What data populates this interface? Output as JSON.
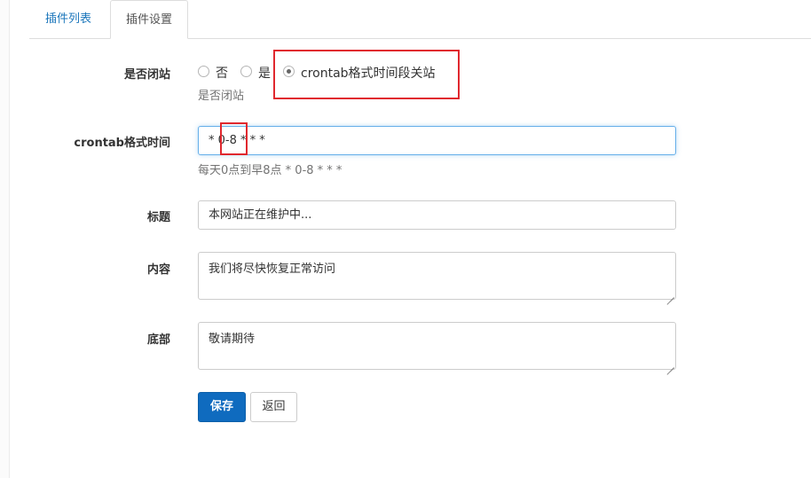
{
  "tabs": [
    {
      "label": "插件列表"
    },
    {
      "label": "插件设置"
    }
  ],
  "form": {
    "close_site": {
      "label": "是否闭站",
      "options": [
        "否",
        "是",
        "crontab格式时间段关站"
      ],
      "selected": "crontab格式时间段关站",
      "help": "是否闭站"
    },
    "crontab": {
      "label": "crontab格式时间",
      "value": "* 0-8 * * *",
      "help": "每天0点到早8点 * 0-8 * * *"
    },
    "title": {
      "label": "标题",
      "value": "本网站正在维护中..."
    },
    "content": {
      "label": "内容",
      "value": "我们将尽快恢复正常访问"
    },
    "footer": {
      "label": "底部",
      "value": "敬请期待"
    }
  },
  "buttons": {
    "save": "保存",
    "back": "返回"
  },
  "colors": {
    "accent": "#0f6bbf",
    "highlight": "#e0282e",
    "link": "#1b76bb"
  }
}
